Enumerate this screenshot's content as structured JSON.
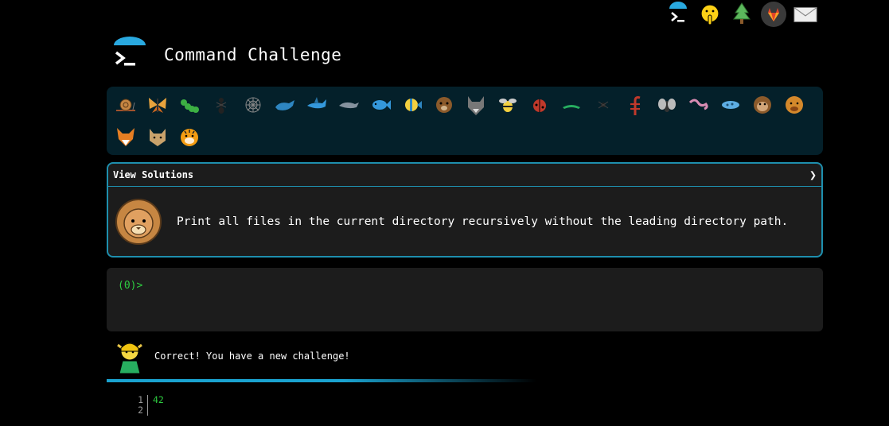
{
  "nav": {
    "icons": [
      {
        "name": "terminal-icon"
      },
      {
        "name": "shush-face-icon"
      },
      {
        "name": "trees-icon"
      },
      {
        "name": "gitlab-icon"
      },
      {
        "name": "mail-icon"
      }
    ]
  },
  "header": {
    "title": "Command Challenge"
  },
  "challenges": [
    {
      "name": "snail"
    },
    {
      "name": "butterfly"
    },
    {
      "name": "caterpillar"
    },
    {
      "name": "ant"
    },
    {
      "name": "spider-web"
    },
    {
      "name": "whale"
    },
    {
      "name": "shark"
    },
    {
      "name": "dolphin"
    },
    {
      "name": "fish"
    },
    {
      "name": "tropical-fish"
    },
    {
      "name": "otter"
    },
    {
      "name": "wolf"
    },
    {
      "name": "bee"
    },
    {
      "name": "ladybug"
    },
    {
      "name": "cricket"
    },
    {
      "name": "spider"
    },
    {
      "name": "scorpion"
    },
    {
      "name": "fly"
    },
    {
      "name": "worm"
    },
    {
      "name": "microbe"
    },
    {
      "name": "monkey"
    },
    {
      "name": "dog"
    },
    {
      "name": "fox"
    },
    {
      "name": "cat"
    },
    {
      "name": "tiger"
    }
  ],
  "panel": {
    "header_label": "View Solutions",
    "challenge_text": "Print all files in the current directory recursively without the leading directory path."
  },
  "terminal": {
    "prompt": "(0)>",
    "input_value": ""
  },
  "status": {
    "message": "Correct! You have a new challenge!"
  },
  "output": {
    "line_numbers": [
      "1",
      "2"
    ],
    "lines": [
      "42",
      ""
    ]
  },
  "colors": {
    "accent": "#1e8fae",
    "prompt_green": "#2ecc40",
    "strip_bg": "#04202a"
  }
}
